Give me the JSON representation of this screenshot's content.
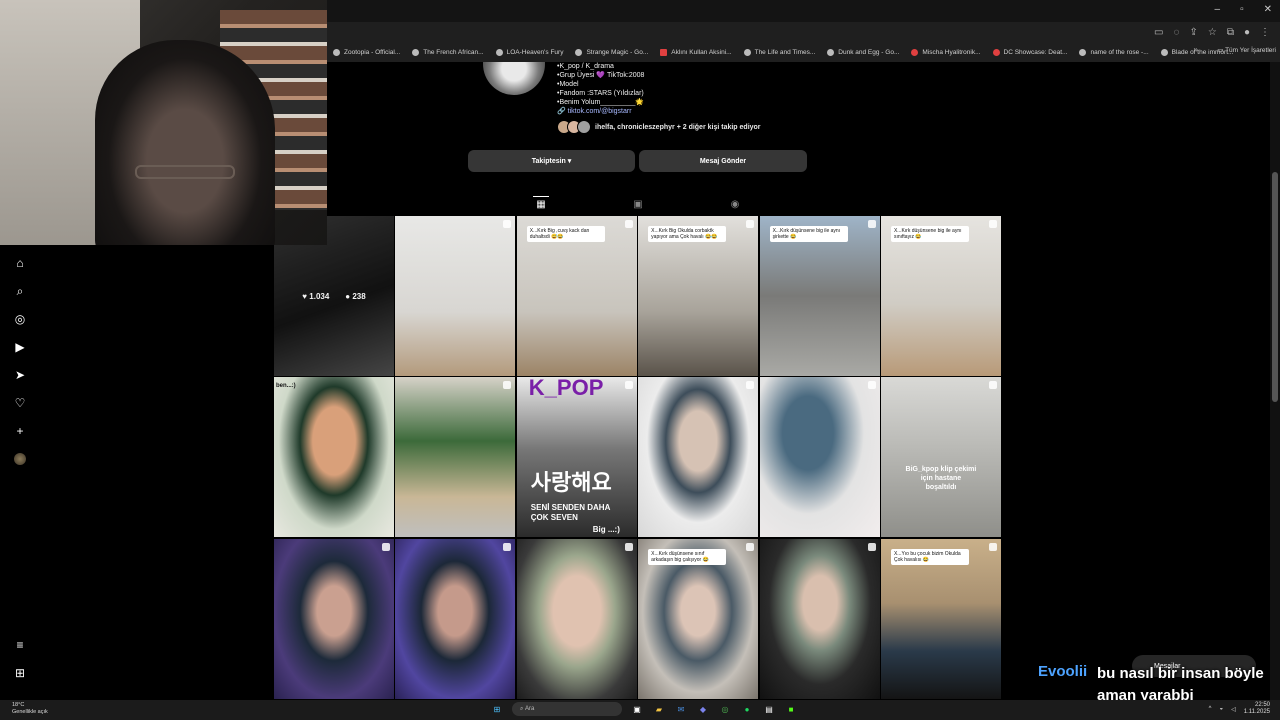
{
  "browser": {
    "window_controls": [
      "–",
      "▫",
      "✕"
    ],
    "bookmarks": [
      {
        "label": "Zootopia - Official..."
      },
      {
        "label": "The French African..."
      },
      {
        "label": "LOA-Heaven's Fury"
      },
      {
        "label": "Strange Magic - Go..."
      },
      {
        "label": "Aklını Kullan Aksini..."
      },
      {
        "label": "The Life and Times..."
      },
      {
        "label": "Dunk and Egg - Go..."
      },
      {
        "label": "Mischa Hyalitronik..."
      },
      {
        "label": "DC Showcase: Deat..."
      },
      {
        "label": "name of the rose -..."
      },
      {
        "label": "Blade of the immort..."
      }
    ],
    "bookmarks_overflow": "»",
    "all_bookmarks_label": "Tüm Yer İşaretleri"
  },
  "profile": {
    "bio_lines": [
      "•K_pop / K_drama",
      "•Grup Üyesi 💜 TikTok:2008",
      "•Model",
      "•Fandom :STARS (Yıldızlar)",
      "•Benim Yolum_________🌟"
    ],
    "link": "🔗 tiktok.com/@bigstarr",
    "followed_by": "ihelfa, chronicleszephyr + 2 diğer kişi takip ediyor",
    "following_button": "Takiptesin ▾",
    "message_button": "Mesaj Gönder"
  },
  "tabs": [
    "▦",
    "▣",
    "◉"
  ],
  "grid": {
    "hover_stats": {
      "likes": "♥ 1.034",
      "comments": "● 238"
    },
    "captions": {
      "t3": "X...Kırk Big ,cuvş kack dan duhaltsdi 😅😂",
      "t4": "X...Kırk Big Okulda corbaktk yapıyor ama Çok havalı 😂😂",
      "t5": "X...Kırk düşünsene big ile aynı şirkette 😂",
      "t6": "X...Kırk düşünsene big ile aynı sınıftayız 😂",
      "t7": "ben...:)",
      "t9_title": "K_POP",
      "t9_korean": "사랑해요",
      "t9_sub": "SENİ SENDEN DAHA ÇOK SEVEN",
      "t9_sign": "Big ...:)",
      "t12": "BiG_kpop klip çekimi için hastane boşaltıldı",
      "t16": "X...Kırk düşünsene sınıf arkadaşın big çalışıyor 😂",
      "t18": "X...Yıo bu çocuk bizim Okulda Çok havalısı 😂"
    }
  },
  "chat": {
    "username": "Evoolii",
    "message": "bu nasıl bir insan böyle aman yarabbi",
    "messages_pill": "Mesajlar"
  },
  "taskbar": {
    "weather_temp": "18°C",
    "weather_desc": "Genellikle açık",
    "search_placeholder": "Ara",
    "time": "22:50",
    "date": "1.11.2025"
  }
}
